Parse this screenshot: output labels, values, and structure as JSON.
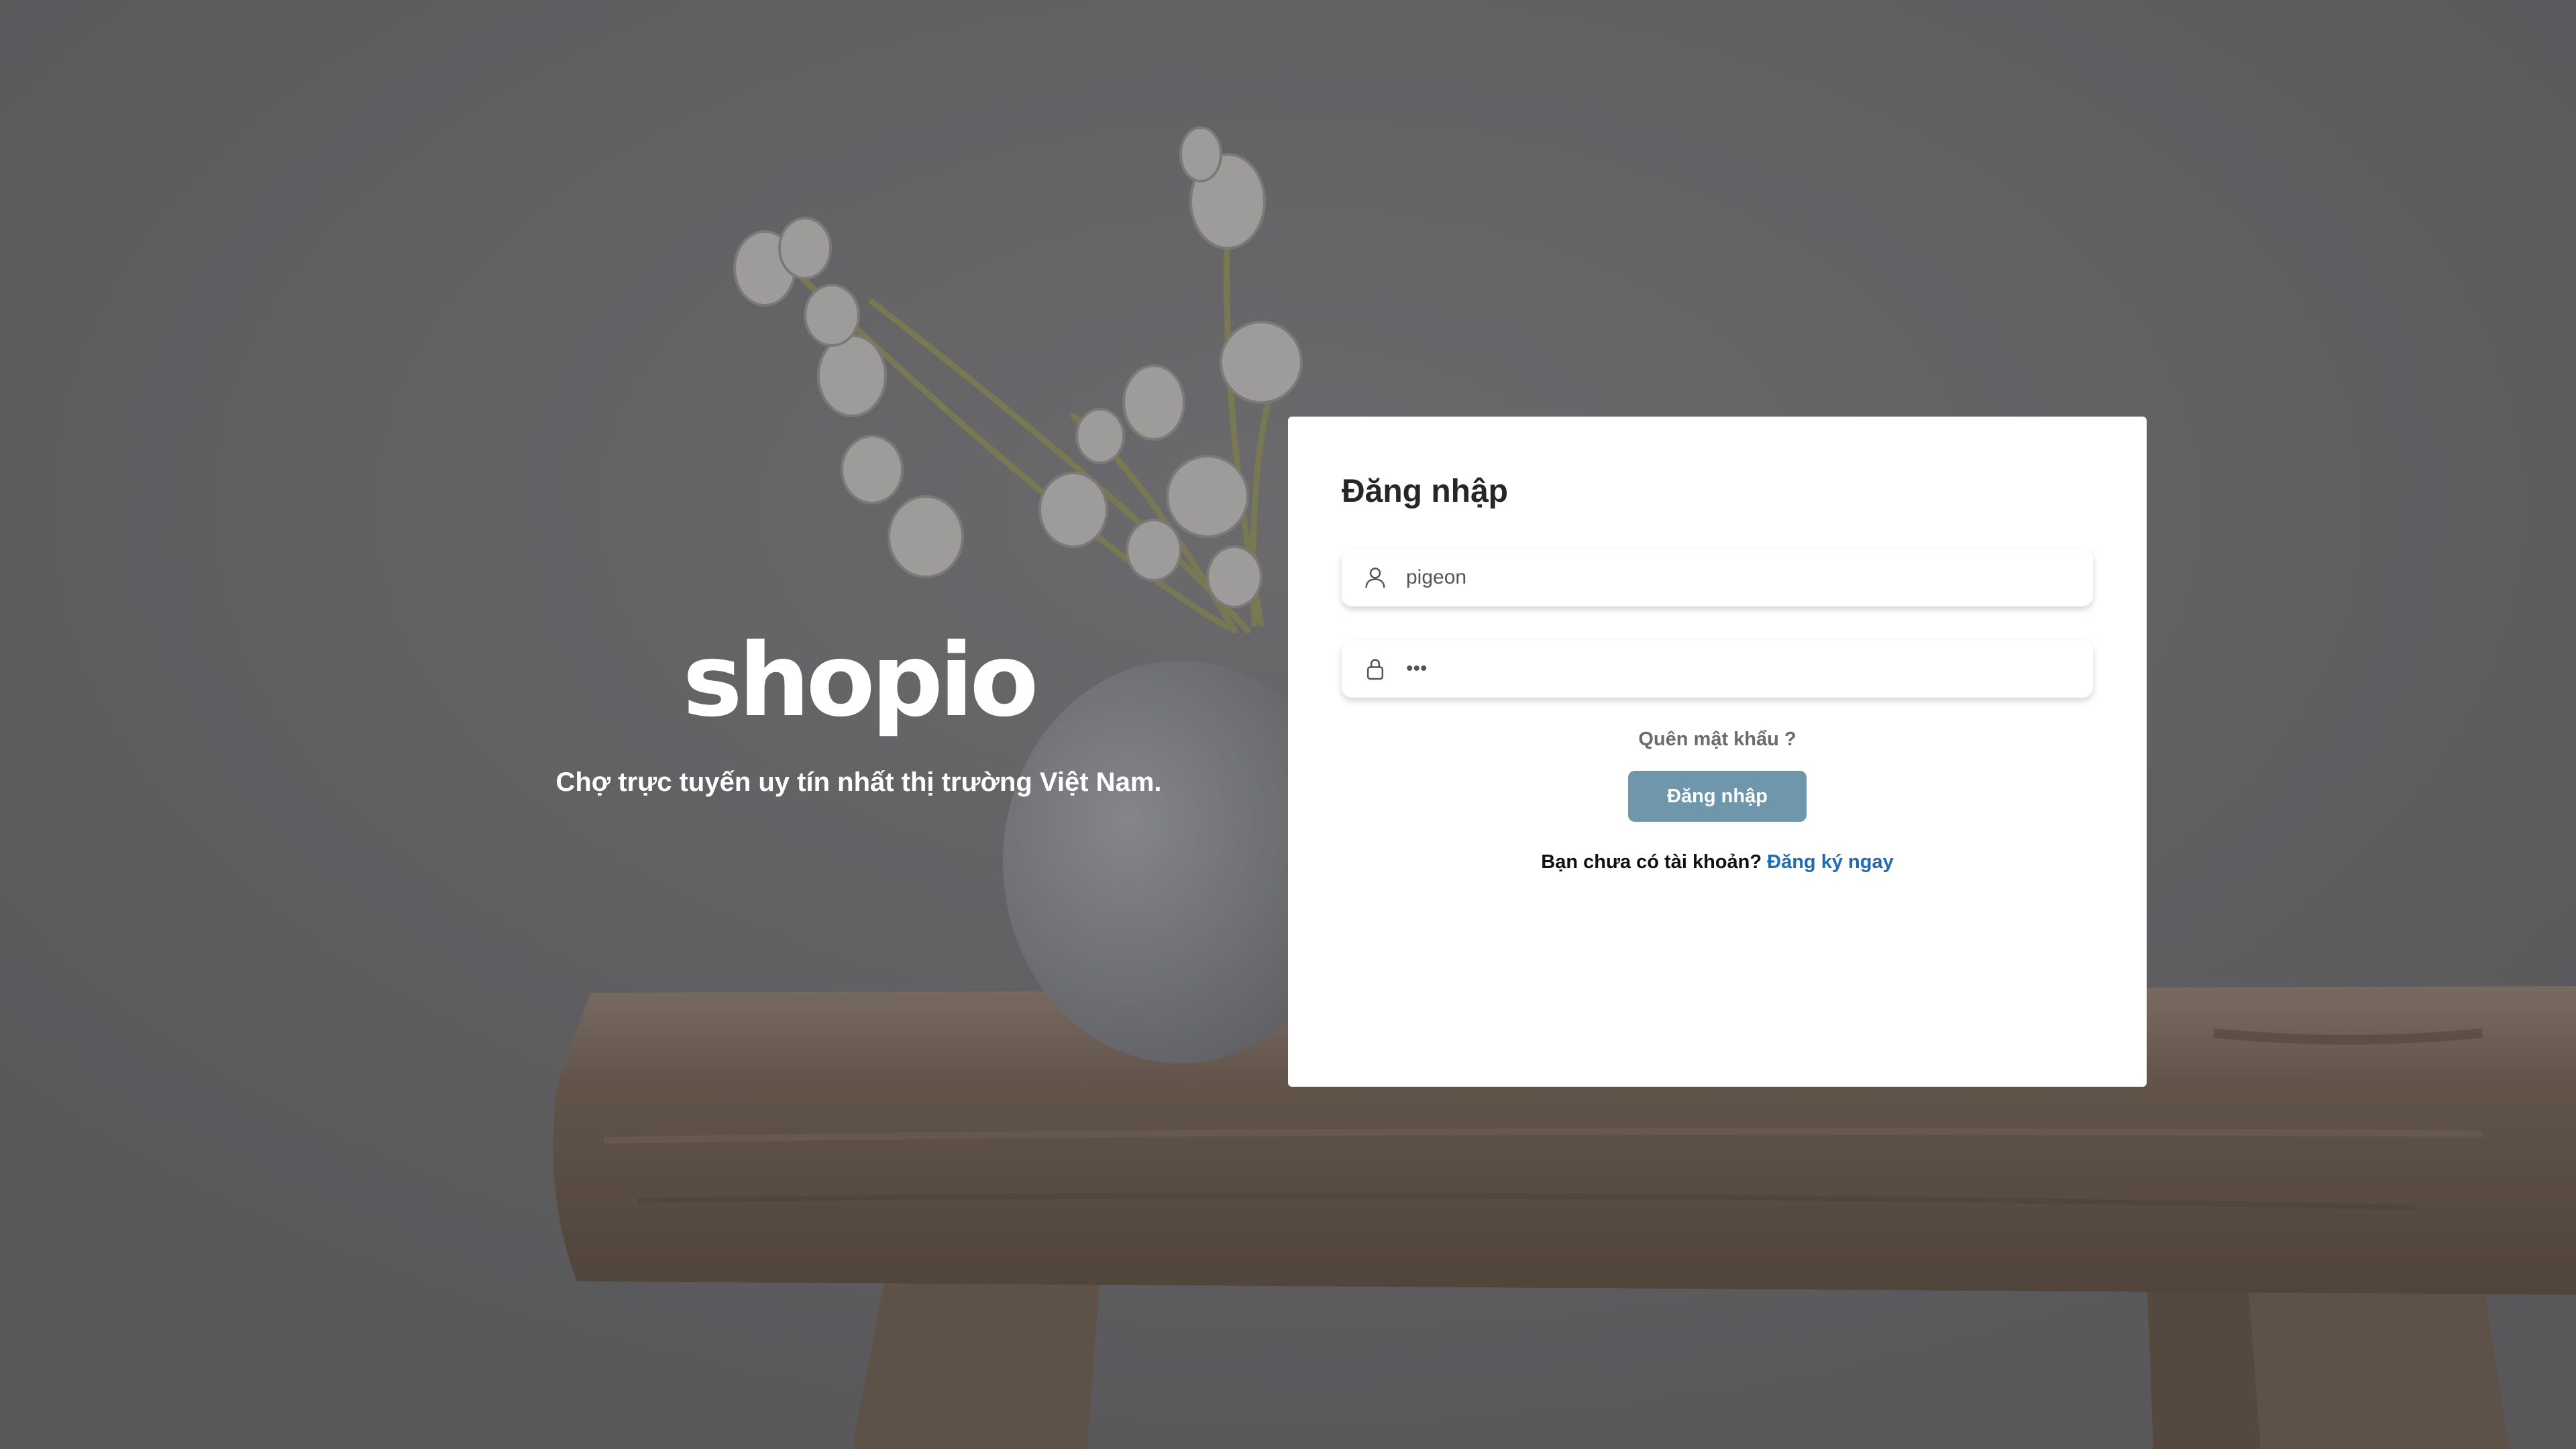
{
  "colors": {
    "card_background": "#ffffff",
    "button_background": "#6f96ab",
    "link": "#1e6cb6"
  },
  "brand": {
    "logo_text": "shopio",
    "tagline": "Chợ trực tuyến uy tín nhất thị trường Việt Nam."
  },
  "login": {
    "title": "Đăng nhập",
    "username_icon": "user-icon",
    "username_value": "pigeon",
    "password_icon": "lock-icon",
    "password_value": "•••",
    "forgot_label": "Quên mật khẩu ?",
    "submit_label": "Đăng nhập",
    "signup_prompt": "Bạn chưa có tài khoản?",
    "signup_link": "Đăng ký ngay"
  }
}
